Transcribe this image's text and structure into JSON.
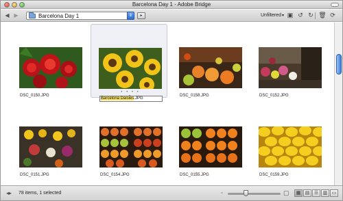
{
  "window": {
    "title": "Barcelona Day 1 - Adobe Bridge"
  },
  "toolbar": {
    "back_icon": "back-arrow-icon",
    "forward_icon": "forward-arrow-icon",
    "path_label": "Barcelona Day 1",
    "filter_label": "Unfiltered",
    "icons": [
      "new-folder-icon",
      "rotate-left-icon",
      "rotate-right-icon",
      "trash-icon",
      "refresh-icon"
    ]
  },
  "thumbnails": [
    {
      "filename": "DSC_0150.JPG",
      "subject": "red roses"
    },
    {
      "filename_highlight": "Barcelona Daisies",
      "filename_rest": ".JPG",
      "subject": "sunflowers",
      "selected": true,
      "rating_dots": "• • • • •"
    },
    {
      "filename": "DSC_0158.JPG",
      "subject": "market fruit stall"
    },
    {
      "filename": "DSC_0152.JPG",
      "subject": "flower market street"
    },
    {
      "filename": "DSC_0151.JPG",
      "subject": "flower stall"
    },
    {
      "filename": "DSC_0154.JPG",
      "subject": "fruit pyramid"
    },
    {
      "filename": "DSC_0155.JPG",
      "subject": "oranges display"
    },
    {
      "filename": "DSC_0159.JPG",
      "subject": "lemons"
    }
  ],
  "status": {
    "text": "78 items, 1 selected",
    "small_label": "▫",
    "large_label": "▢"
  },
  "colors": {
    "selection_bg": "#eef0f5",
    "highlight": "#f6e26b",
    "scroll_accent": "#3a7ad7"
  }
}
